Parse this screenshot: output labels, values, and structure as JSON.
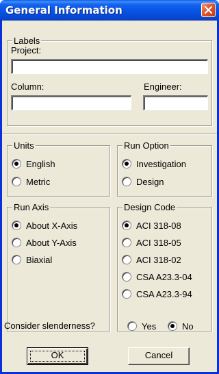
{
  "window": {
    "title": "General Information"
  },
  "labels_group": {
    "legend": "Labels",
    "project_label": "Project:",
    "project_value": "",
    "column_label": "Column:",
    "column_value": "",
    "engineer_label": "Engineer:",
    "engineer_value": ""
  },
  "units": {
    "legend": "Units",
    "options": [
      {
        "label": "English",
        "selected": true
      },
      {
        "label": "Metric",
        "selected": false
      }
    ]
  },
  "run_option": {
    "legend": "Run Option",
    "options": [
      {
        "label": "Investigation",
        "selected": true
      },
      {
        "label": "Design",
        "selected": false
      }
    ]
  },
  "run_axis": {
    "legend": "Run Axis",
    "options": [
      {
        "label": "About X-Axis",
        "selected": true
      },
      {
        "label": "About Y-Axis",
        "selected": false
      },
      {
        "label": "Biaxial",
        "selected": false
      }
    ]
  },
  "design_code": {
    "legend": "Design Code",
    "options": [
      {
        "label": "ACI 318-08",
        "selected": true
      },
      {
        "label": "ACI 318-05",
        "selected": false
      },
      {
        "label": "ACI 318-02",
        "selected": false
      },
      {
        "label": "CSA A23.3-04",
        "selected": false
      },
      {
        "label": "CSA A23.3-94",
        "selected": false
      }
    ]
  },
  "slenderness": {
    "label": "Consider slenderness?",
    "options": [
      {
        "label": "Yes",
        "selected": false
      },
      {
        "label": "No",
        "selected": true
      }
    ]
  },
  "buttons": {
    "ok": "OK",
    "cancel": "Cancel"
  },
  "colors": {
    "titlebar": "#0854e3",
    "close_button": "#e2542c",
    "dialog_face": "#ece9d8"
  }
}
